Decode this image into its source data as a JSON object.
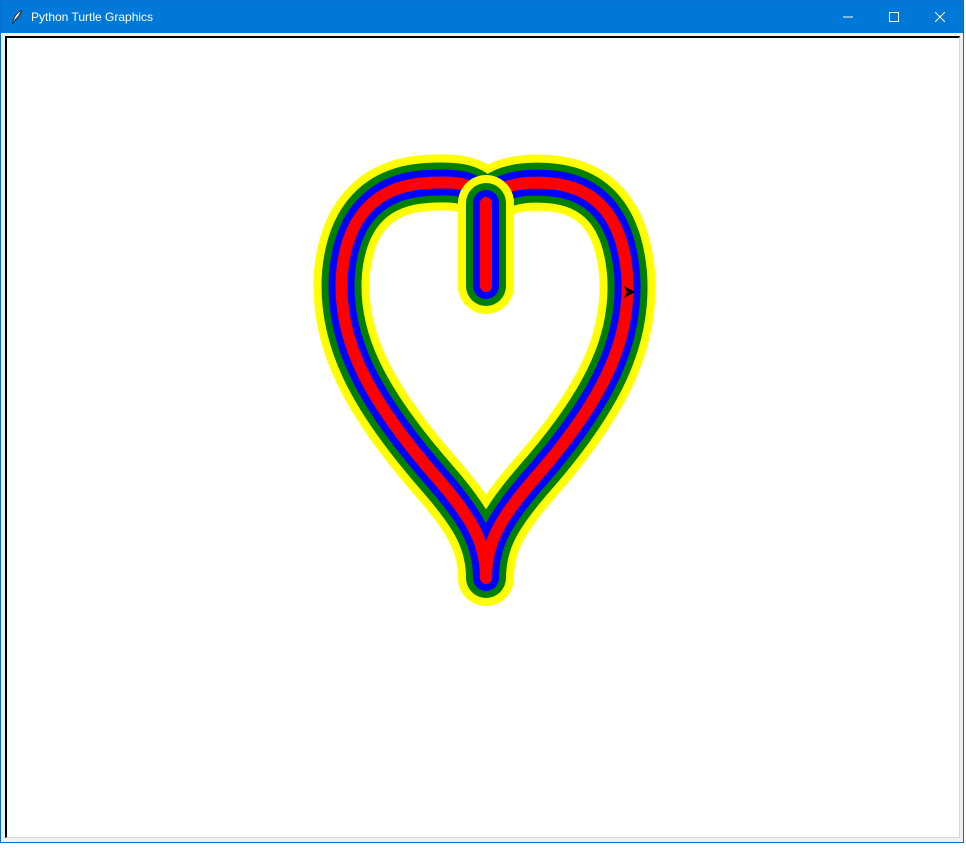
{
  "window": {
    "title": "Python Turtle Graphics",
    "icon": "feather-icon",
    "controls": [
      "minimize-icon",
      "maximize-icon",
      "close-icon"
    ]
  },
  "canvas": {
    "background": "#ffffff",
    "drawing": {
      "shape": "heart",
      "stroke_colors_outer_to_inner": [
        "#ffff00",
        "#008000",
        "#0000ff",
        "#ff0000"
      ],
      "inner_fill": "#ffffff",
      "turtle_cursor": "arrow-icon",
      "turtle_color": "#000000"
    }
  },
  "colors": {
    "titlebar": "#0078d7",
    "title_text": "#ffffff"
  }
}
